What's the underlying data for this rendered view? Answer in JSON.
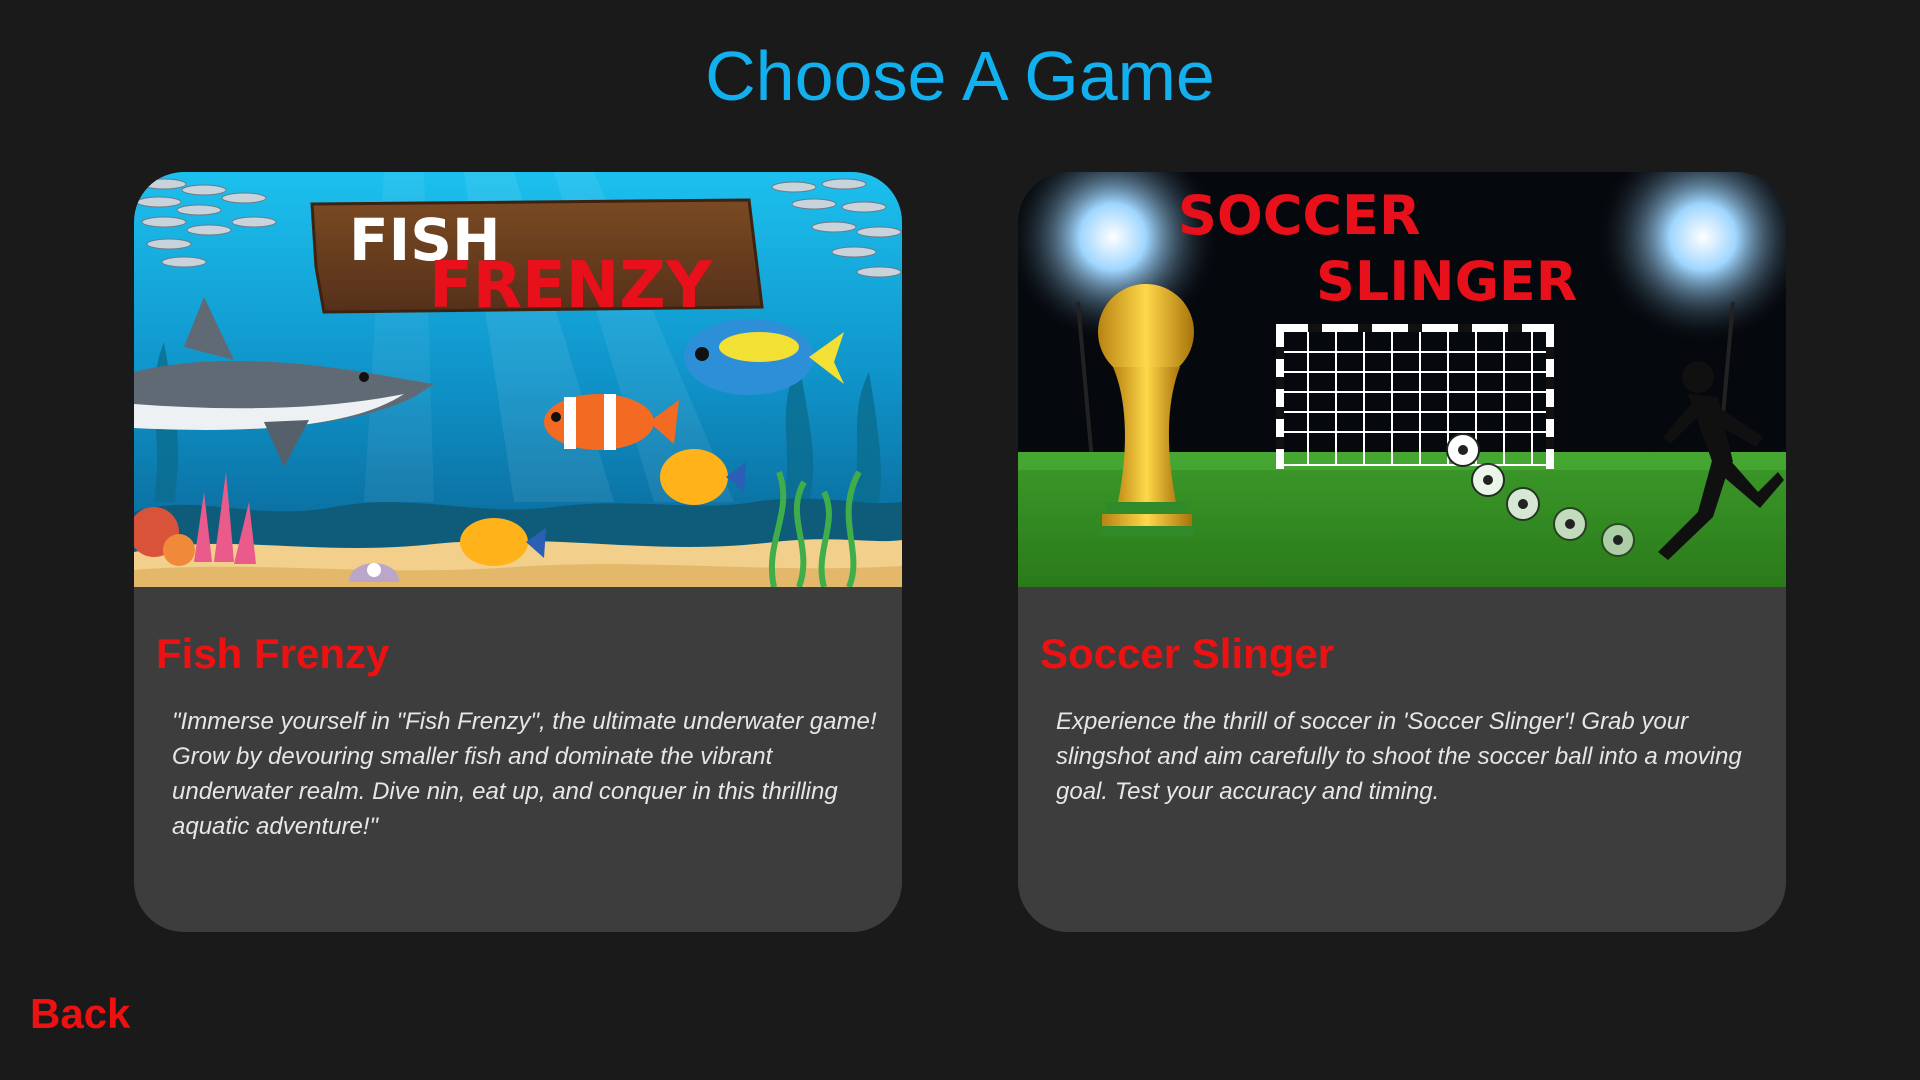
{
  "page": {
    "title": "Choose A Game"
  },
  "games": [
    {
      "banner_line1": "FISH",
      "banner_line2": "FRENZY",
      "name": "Fish Frenzy",
      "description": "\"Immerse  yourself  in \"Fish Frenzy\",  the  ultimate underwater game!  Grow  by devouring  smaller  fish  and  dominate the vibrant  underwater realm. Dive nin, eat up, and conquer in this thrilling aquatic adventure!\""
    },
    {
      "banner_line1": "SOCCER",
      "banner_line2": "SLINGER",
      "name": "Soccer Slinger",
      "description": "Experience the thrill of soccer in 'Soccer Slinger'! Grab your slingshot and aim carefully to shoot the soccer ball into a moving goal. Test your accuracy and timing."
    }
  ],
  "navigation": {
    "back_label": "Back"
  },
  "colors": {
    "background": "#1a1a1a",
    "title": "#12b0ee",
    "card": "#3d3d3d",
    "accent_red": "#ee1111",
    "description_text": "#e6e6e6"
  }
}
